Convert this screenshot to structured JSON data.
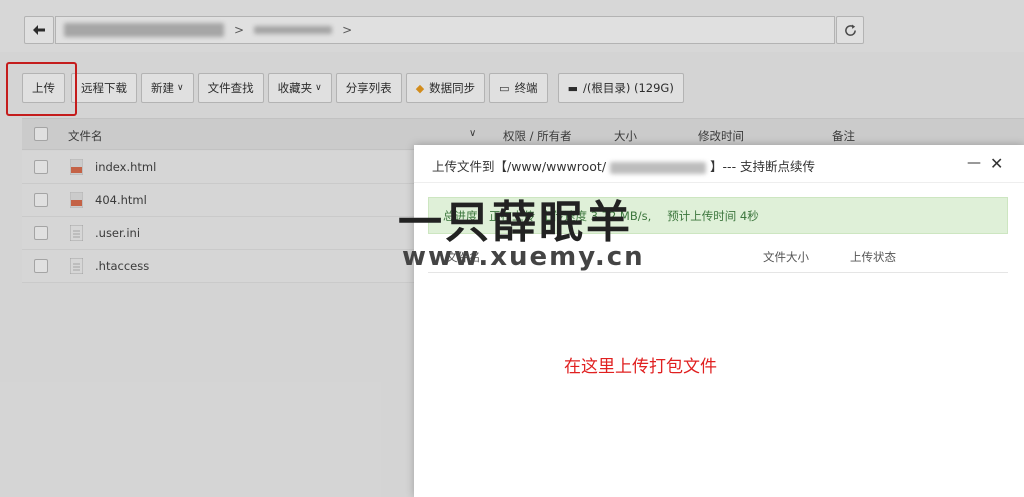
{
  "address_bar": {
    "back_icon": "arrow-left-icon",
    "refresh_icon": "refresh-icon",
    "separator": ">"
  },
  "toolbar": {
    "upload": "上传",
    "remote_download": "远程下载",
    "new": "新建",
    "file_search": "文件查找",
    "favorites": "收藏夹",
    "share_list": "分享列表",
    "data_sync": "数据同步",
    "terminal": "终端",
    "disk": "/(根目录) (129G)"
  },
  "table": {
    "headers": {
      "name": "文件名",
      "permission": "权限 / 所有者",
      "size": "大小",
      "modified": "修改时间",
      "note": "备注"
    },
    "rows": [
      {
        "name": "index.html",
        "icon": "html-file-icon"
      },
      {
        "name": "404.html",
        "icon": "html-file-icon"
      },
      {
        "name": ".user.ini",
        "icon": "text-file-icon"
      },
      {
        "name": ".htaccess",
        "icon": "text-file-icon"
      }
    ]
  },
  "dialog": {
    "title_prefix": "上传文件到【/www/wwwroot/",
    "title_suffix": "】--- 支持断点续传",
    "status_progress": "总进度：正在上传",
    "status_speed": "上传速度 3.72 MB/s,",
    "status_eta": "预计上传时间 4秒",
    "col_name": "文件名",
    "col_size": "文件大小",
    "col_state": "上传状态",
    "hint": "在这里上传打包文件"
  },
  "watermark": {
    "line1": "一只薛眠羊",
    "line2": "www.xuemy.cn"
  },
  "colors": {
    "highlight": "#e02020",
    "status_bg": "#dff0d8",
    "status_text": "#3c763d"
  }
}
